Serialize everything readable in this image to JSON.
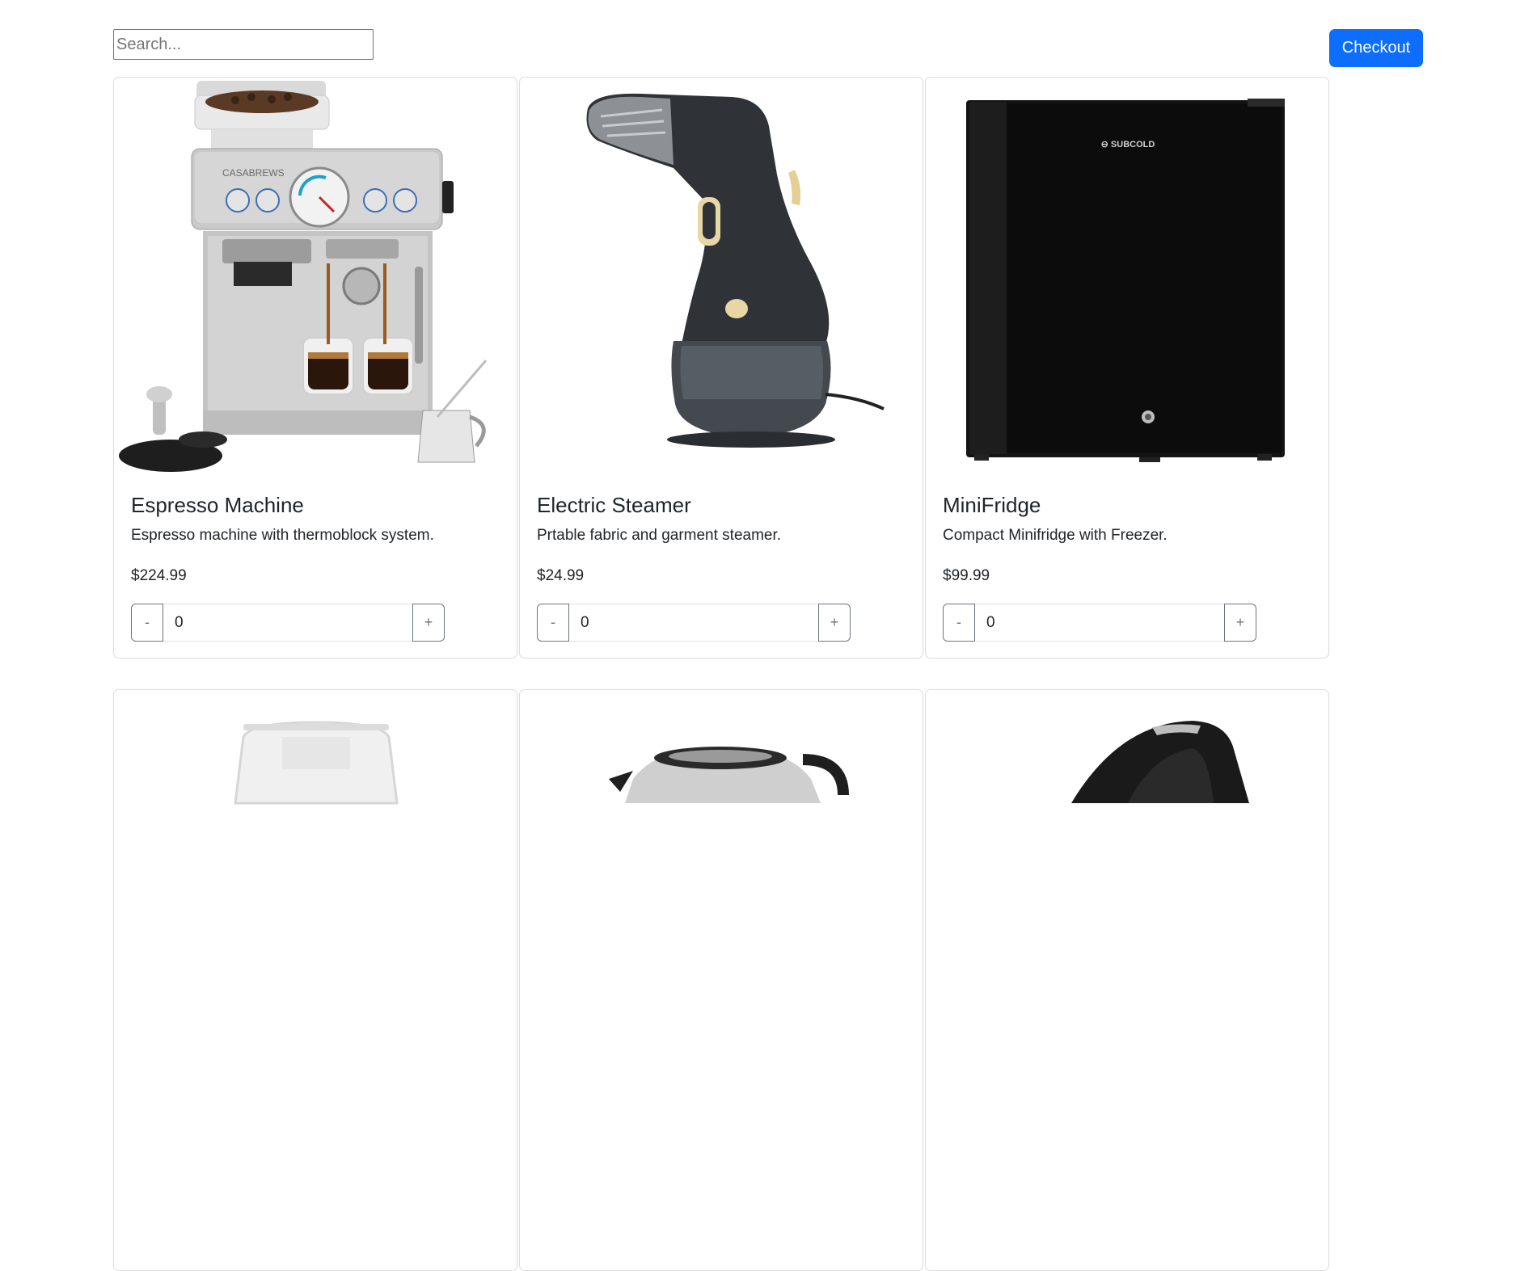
{
  "search": {
    "placeholder": "Search..."
  },
  "header": {
    "checkout_label": "Checkout"
  },
  "products": [
    {
      "name": "Espresso Machine",
      "description": "Espresso machine with thermoblock system.",
      "price": "$224.99",
      "quantity": "0",
      "minus_label": "-",
      "plus_label": "+",
      "image_brand_text": "CASABREWS"
    },
    {
      "name": "Electric Steamer",
      "description": "Prtable fabric and garment steamer.",
      "price": "$24.99",
      "quantity": "0",
      "minus_label": "-",
      "plus_label": "+"
    },
    {
      "name": "MiniFridge",
      "description": "Compact Minifridge with Freezer.",
      "price": "$99.99",
      "quantity": "0",
      "minus_label": "-",
      "plus_label": "+",
      "image_brand_text": "SUBCOLD"
    },
    {
      "name": "",
      "image": "blender-icon"
    },
    {
      "name": "",
      "image": "kettle-icon"
    },
    {
      "name": "",
      "image": "handheld-appliance-icon"
    }
  ],
  "colors": {
    "primary": "#0d6efd",
    "card_border": "#dcdcdc",
    "stepper_border": "#6c757d"
  }
}
